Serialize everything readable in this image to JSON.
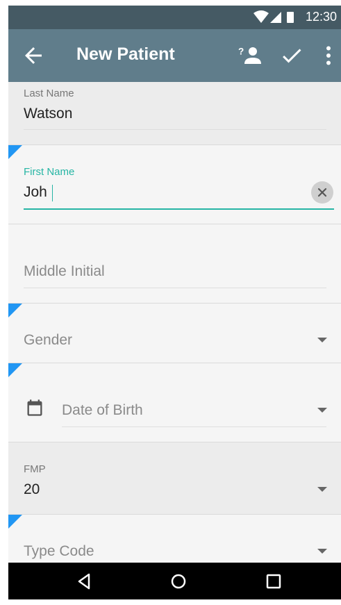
{
  "status_bar": {
    "time": "12:30"
  },
  "app_bar": {
    "title": "New Patient"
  },
  "fields": {
    "last_name": {
      "label": "Last Name",
      "value": "Watson"
    },
    "first_name": {
      "label": "First Name",
      "value": "Joh"
    },
    "middle_initial": {
      "placeholder": "Middle Initial"
    },
    "gender": {
      "placeholder": "Gender"
    },
    "date_of_birth": {
      "placeholder": "Date of Birth"
    },
    "fmp": {
      "label": "FMP",
      "value": "20"
    },
    "type_code": {
      "placeholder": "Type Code"
    }
  },
  "colors": {
    "accent": "#26b5a4",
    "required_flag": "#2196f3",
    "app_bar": "#607d8b",
    "status_bar": "#455a64"
  },
  "icons": [
    "back-arrow-icon",
    "patient-lookup-icon",
    "check-icon",
    "more-vert-icon",
    "clear-icon",
    "calendar-icon",
    "dropdown-arrow-icon",
    "nav-back-icon",
    "nav-home-icon",
    "nav-recents-icon"
  ]
}
